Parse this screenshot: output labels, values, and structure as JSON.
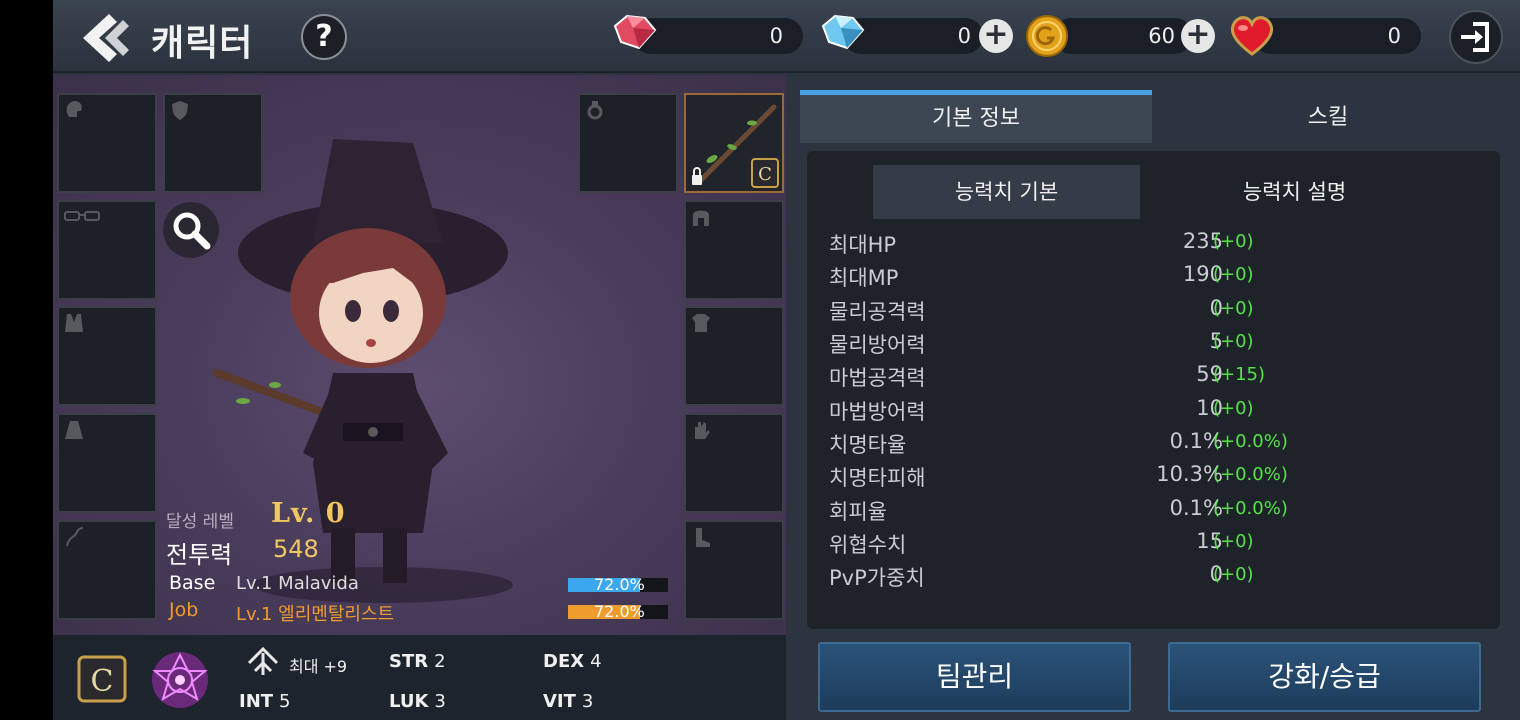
{
  "header": {
    "title": "캐릭터",
    "help_label": "?",
    "currencies": [
      {
        "name": "red-gem",
        "amount": "0",
        "color": "#e24a62"
      },
      {
        "name": "blue-gem",
        "amount": "0",
        "color": "#6ec8f0"
      },
      {
        "name": "gold-coin",
        "amount": "60",
        "color": "#e3a21c"
      },
      {
        "name": "heart",
        "amount": "0",
        "color": "#e01b2b"
      }
    ]
  },
  "character": {
    "achieve_label": "달성 레벨",
    "achieve_value": "Lv. 0",
    "power_label": "전투력",
    "power_value": "548",
    "base_label": "Base",
    "base_value": "Lv.1 Malavida",
    "job_label": "Job",
    "job_value": "Lv.1 엘리멘탈리스트",
    "base_exp": {
      "percent_text": "72.0%",
      "fraction": 0.72,
      "color": "#3aa7ee"
    },
    "job_exp": {
      "percent_text": "72.0%",
      "fraction": 0.72,
      "color": "#ef9b2d"
    }
  },
  "equipment": {
    "left_slots": [
      "head-icon",
      "shield-icon",
      "glasses-icon",
      "armor-icon",
      "cloak-icon",
      "necklace-icon"
    ],
    "right_slots": [
      "ring-icon",
      "staff-weapon",
      "helmet-icon",
      "chest-armor-icon",
      "glove-icon",
      "boot-icon"
    ]
  },
  "attributes": {
    "max_label": "최대 +9",
    "str": {
      "label": "STR",
      "value": "2"
    },
    "dex": {
      "label": "DEX",
      "value": "4"
    },
    "int": {
      "label": "INT",
      "value": "5"
    },
    "luk": {
      "label": "LUK",
      "value": "3"
    },
    "vit": {
      "label": "VIT",
      "value": "3"
    }
  },
  "tabs": {
    "basic_info": "기본 정보",
    "skill": "스킬"
  },
  "subtabs": {
    "stat_basic": "능력치 기본",
    "stat_desc": "능력치 설명"
  },
  "stats": [
    {
      "name": "최대HP",
      "value": "235",
      "bonus": "(+0)"
    },
    {
      "name": "최대MP",
      "value": "190",
      "bonus": "(+0)"
    },
    {
      "name": "물리공격력",
      "value": "0",
      "bonus": "(+0)"
    },
    {
      "name": "물리방어력",
      "value": "5",
      "bonus": "(+0)"
    },
    {
      "name": "마법공격력",
      "value": "59",
      "bonus": "(+15)"
    },
    {
      "name": "마법방어력",
      "value": "10",
      "bonus": "(+0)"
    },
    {
      "name": "치명타율",
      "value": "0.1%",
      "bonus": "(+0.0%)"
    },
    {
      "name": "치명타피해",
      "value": "10.3%",
      "bonus": "(+0.0%)"
    },
    {
      "name": "회피율",
      "value": "0.1%",
      "bonus": "(+0.0%)"
    },
    {
      "name": "위협수치",
      "value": "15",
      "bonus": "(+0)"
    },
    {
      "name": "PvP가중치",
      "value": "0",
      "bonus": "(+0)"
    }
  ],
  "buttons": {
    "team_manage": "팀관리",
    "enhance": "강화/승급"
  }
}
